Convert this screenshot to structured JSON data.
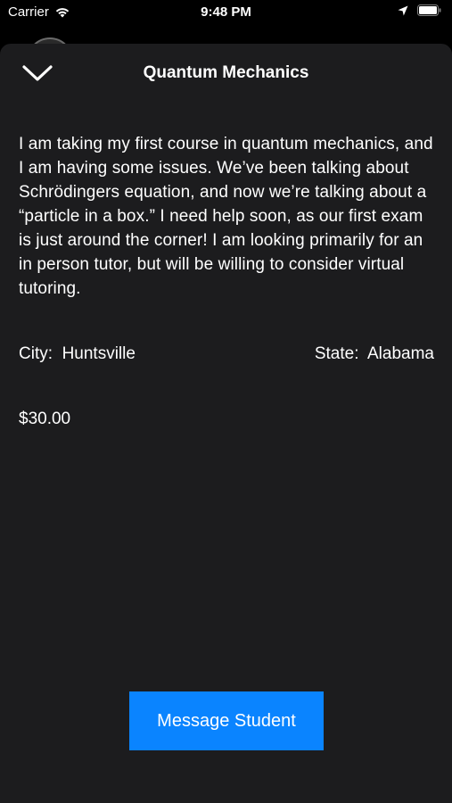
{
  "status_bar": {
    "carrier": "Carrier",
    "time": "9:48 PM"
  },
  "sheet": {
    "title": "Quantum Mechanics",
    "description": "I am taking my first course in quantum mechanics, and I am having some issues. We’ve been talking about Schrödingers equation, and now we’re talking about a “particle in a box.” I need help soon, as our first exam is just around the corner! I am looking primarily for an in person tutor, but will be willing to consider virtual tutoring.",
    "city_label": "City:",
    "city_value": "Huntsville",
    "state_label": "State:",
    "state_value": "Alabama",
    "price": "$30.00",
    "message_button": "Message Student"
  },
  "colors": {
    "background": "#000000",
    "sheet": "#1c1c1e",
    "accent": "#0a84ff",
    "text": "#ffffff"
  },
  "icons": {
    "wifi": "wifi-icon",
    "location": "location-arrow-icon",
    "battery": "battery-icon",
    "dismiss": "chevron-down-icon"
  }
}
